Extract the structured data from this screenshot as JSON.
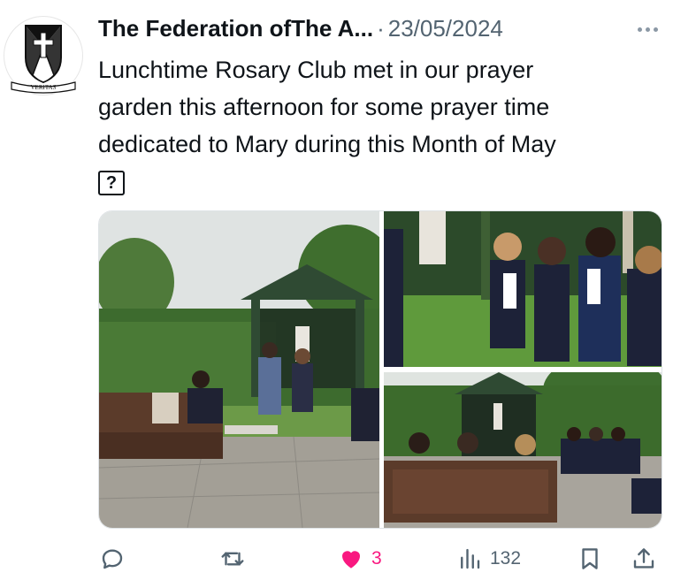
{
  "post": {
    "author_name": "The Federation ofThe A...",
    "separator": "·",
    "date": "23/05/2024",
    "text_lines": [
      "Lunchtime Rosary Club met in our prayer",
      "garden this afternoon for some prayer time",
      "dedicated to Mary during this Month of May"
    ],
    "unsupported_glyph": "?",
    "avatar_motto": "VERITAS"
  },
  "media": {
    "photos": [
      "garden-wide-photo",
      "students-praying-closeup-photo",
      "students-group-garden-photo"
    ]
  },
  "actions": {
    "reply_icon": "reply-icon",
    "repost_icon": "repost-icon",
    "like_icon": "heart-filled-icon",
    "like_count": "3",
    "views_icon": "views-bar-icon",
    "view_count": "132",
    "bookmark_icon": "bookmark-icon",
    "share_icon": "share-icon"
  },
  "colors": {
    "text_primary": "#0f1419",
    "text_secondary": "#536471",
    "like_pink": "#f91880"
  }
}
